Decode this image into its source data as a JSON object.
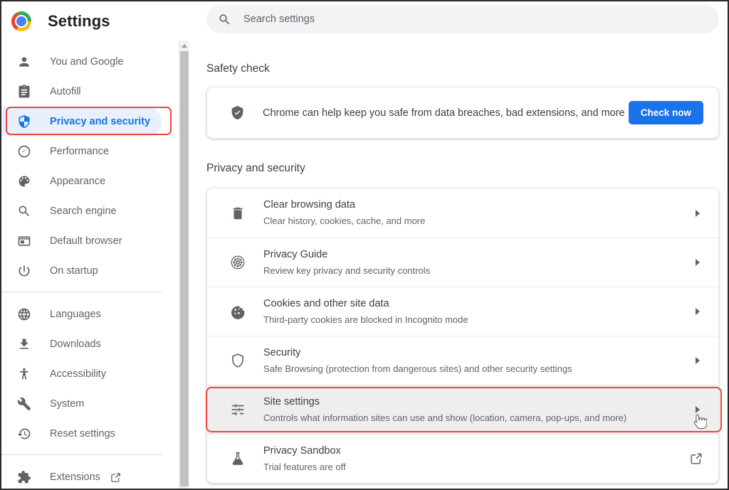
{
  "app": {
    "title": "Settings",
    "logo_icon": "chrome-logo"
  },
  "search": {
    "placeholder": "Search settings",
    "value": "",
    "icon": "search-icon"
  },
  "sidebar": {
    "groups": [
      {
        "items": [
          {
            "label": "You and Google",
            "icon": "person-icon",
            "selected": false
          },
          {
            "label": "Autofill",
            "icon": "clipboard-icon",
            "selected": false
          },
          {
            "label": "Privacy and security",
            "icon": "shield-icon",
            "selected": true
          },
          {
            "label": "Performance",
            "icon": "speedometer-icon",
            "selected": false
          },
          {
            "label": "Appearance",
            "icon": "palette-icon",
            "selected": false
          },
          {
            "label": "Search engine",
            "icon": "magnifier-icon",
            "selected": false
          },
          {
            "label": "Default browser",
            "icon": "browser-window-icon",
            "selected": false
          },
          {
            "label": "On startup",
            "icon": "power-icon",
            "selected": false
          }
        ]
      },
      {
        "items": [
          {
            "label": "Languages",
            "icon": "globe-icon",
            "selected": false
          },
          {
            "label": "Downloads",
            "icon": "download-icon",
            "selected": false
          },
          {
            "label": "Accessibility",
            "icon": "accessibility-icon",
            "selected": false
          },
          {
            "label": "System",
            "icon": "wrench-icon",
            "selected": false
          },
          {
            "label": "Reset settings",
            "icon": "history-icon",
            "selected": false
          }
        ]
      },
      {
        "items": [
          {
            "label": "Extensions",
            "icon": "puzzle-icon",
            "external": true,
            "selected": false
          }
        ]
      }
    ]
  },
  "safety_check": {
    "heading": "Safety check",
    "icon": "shield-check-icon",
    "description": "Chrome can help keep you safe from data breaches, bad extensions, and more",
    "button_label": "Check now"
  },
  "privacy_security": {
    "heading": "Privacy and security",
    "rows": [
      {
        "title": "Clear browsing data",
        "subtitle": "Clear history, cookies, cache, and more",
        "icon": "trash-icon",
        "action": "chevron",
        "hovered": false
      },
      {
        "title": "Privacy Guide",
        "subtitle": "Review key privacy and security controls",
        "icon": "compass-icon",
        "action": "chevron",
        "hovered": false
      },
      {
        "title": "Cookies and other site data",
        "subtitle": "Third-party cookies are blocked in Incognito mode",
        "icon": "cookie-icon",
        "action": "chevron",
        "hovered": false
      },
      {
        "title": "Security",
        "subtitle": "Safe Browsing (protection from dangerous sites) and other security settings",
        "icon": "shield-outline-icon",
        "action": "chevron",
        "hovered": false
      },
      {
        "title": "Site settings",
        "subtitle": "Controls what information sites can use and show (location, camera, pop-ups, and more)",
        "icon": "sliders-icon",
        "action": "chevron",
        "hovered": true
      },
      {
        "title": "Privacy Sandbox",
        "subtitle": "Trial features are off",
        "icon": "flask-icon",
        "action": "external-link",
        "hovered": false
      }
    ]
  },
  "annotations": {
    "color": "#f0453a",
    "targets": [
      "Privacy and security",
      "Site settings"
    ]
  },
  "cursor": {
    "type": "pointing-hand"
  },
  "colors": {
    "accent": "#1a73e8",
    "selected_bg": "#e8f0fe",
    "annotation": "#f0453a",
    "text_primary": "#3c4043",
    "text_secondary": "#5f6368"
  }
}
